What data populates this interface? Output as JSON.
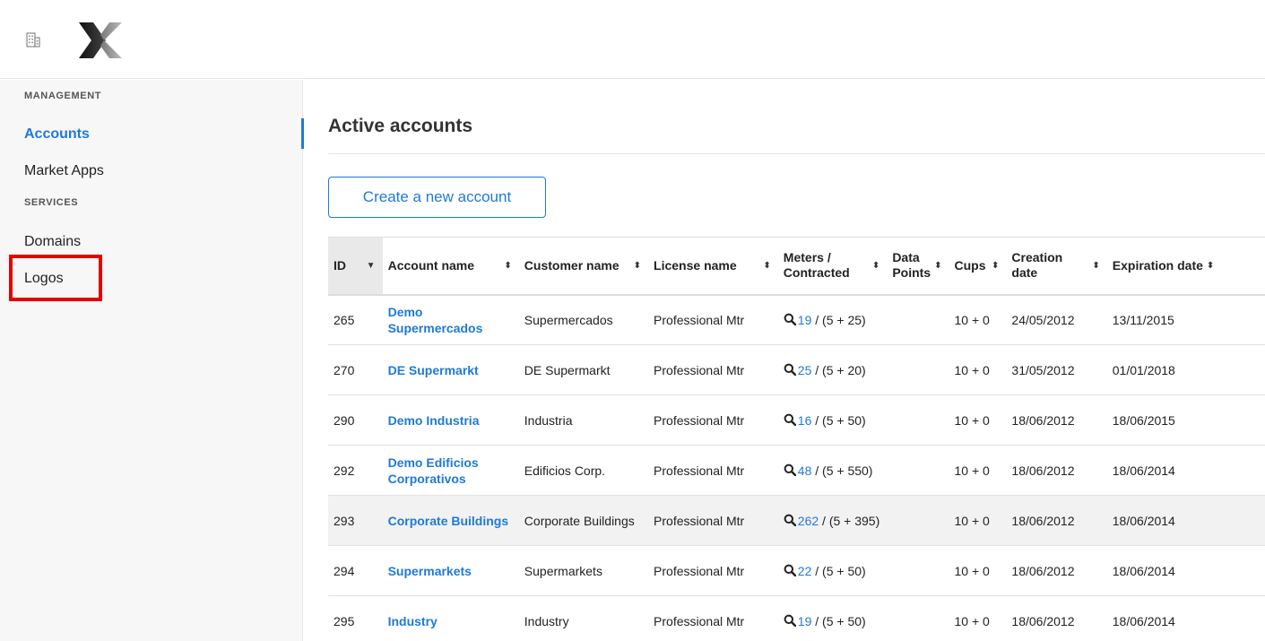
{
  "header": {
    "building_icon": "building-icon",
    "logo": "x-logo"
  },
  "sidebar": {
    "sections": [
      {
        "label": "MANAGEMENT"
      },
      {
        "label": "SERVICES"
      }
    ],
    "items": [
      {
        "label": "Accounts",
        "active": true
      },
      {
        "label": "Market Apps"
      },
      {
        "label": "Domains"
      },
      {
        "label": "Logos",
        "highlighted": true
      }
    ]
  },
  "main": {
    "title": "Active accounts",
    "create_button": "Create a new account"
  },
  "table": {
    "columns": [
      {
        "label": "ID",
        "sort": "desc"
      },
      {
        "label": "Account name"
      },
      {
        "label": "Customer name"
      },
      {
        "label": "License name"
      },
      {
        "label": "Meters / Contracted"
      },
      {
        "label": "Data Points"
      },
      {
        "label": "Cups"
      },
      {
        "label": "Creation date"
      },
      {
        "label": "Expiration date"
      }
    ],
    "rows": [
      {
        "id": "265",
        "account": "Demo Supermercados",
        "customer": "Supermercados",
        "license": "Professional Mtr",
        "meters": "19",
        "contracted": "/ (5 + 25)",
        "data_points": "",
        "cups": "10 + 0",
        "created": "24/05/2012",
        "expires": "13/11/2015"
      },
      {
        "id": "270",
        "account": "DE Supermarkt",
        "customer": "DE Supermarkt",
        "license": "Professional Mtr",
        "meters": "25",
        "contracted": "/ (5 + 20)",
        "data_points": "",
        "cups": "10 + 0",
        "created": "31/05/2012",
        "expires": "01/01/2018"
      },
      {
        "id": "290",
        "account": "Demo Industria",
        "customer": "Industria",
        "license": "Professional Mtr",
        "meters": "16",
        "contracted": "/ (5 + 50)",
        "data_points": "",
        "cups": "10 + 0",
        "created": "18/06/2012",
        "expires": "18/06/2015"
      },
      {
        "id": "292",
        "account": "Demo Edificios Corporativos",
        "customer": "Edificios Corp.",
        "license": "Professional Mtr",
        "meters": "48",
        "contracted": "/ (5 + 550)",
        "data_points": "",
        "cups": "10 + 0",
        "created": "18/06/2012",
        "expires": "18/06/2014"
      },
      {
        "id": "293",
        "account": "Corporate Buildings",
        "customer": "Corporate Buildings",
        "license": "Professional Mtr",
        "meters": "262",
        "contracted": "/ (5 + 395)",
        "data_points": "",
        "cups": "10 + 0",
        "created": "18/06/2012",
        "expires": "18/06/2014",
        "hover": true
      },
      {
        "id": "294",
        "account": "Supermarkets",
        "customer": "Supermarkets",
        "license": "Professional Mtr",
        "meters": "22",
        "contracted": "/ (5 + 50)",
        "data_points": "",
        "cups": "10 + 0",
        "created": "18/06/2012",
        "expires": "18/06/2014"
      },
      {
        "id": "295",
        "account": "Industry",
        "customer": "Industry",
        "license": "Professional Mtr",
        "meters": "19",
        "contracted": "/ (5 + 50)",
        "data_points": "",
        "cups": "10 + 0",
        "created": "18/06/2012",
        "expires": "18/06/2014"
      }
    ]
  },
  "colors": {
    "accent": "#1e7ad6",
    "highlight": "#e60000"
  }
}
